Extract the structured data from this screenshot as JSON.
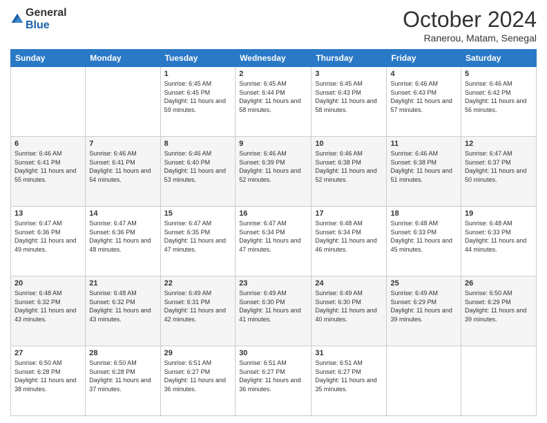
{
  "logo": {
    "general": "General",
    "blue": "Blue"
  },
  "header": {
    "month": "October 2024",
    "location": "Ranerou, Matam, Senegal"
  },
  "days_of_week": [
    "Sunday",
    "Monday",
    "Tuesday",
    "Wednesday",
    "Thursday",
    "Friday",
    "Saturday"
  ],
  "weeks": [
    [
      {
        "day": "",
        "sunrise": "",
        "sunset": "",
        "daylight": ""
      },
      {
        "day": "",
        "sunrise": "",
        "sunset": "",
        "daylight": ""
      },
      {
        "day": "1",
        "sunrise": "Sunrise: 6:45 AM",
        "sunset": "Sunset: 6:45 PM",
        "daylight": "Daylight: 11 hours and 59 minutes."
      },
      {
        "day": "2",
        "sunrise": "Sunrise: 6:45 AM",
        "sunset": "Sunset: 6:44 PM",
        "daylight": "Daylight: 11 hours and 58 minutes."
      },
      {
        "day": "3",
        "sunrise": "Sunrise: 6:45 AM",
        "sunset": "Sunset: 6:43 PM",
        "daylight": "Daylight: 11 hours and 58 minutes."
      },
      {
        "day": "4",
        "sunrise": "Sunrise: 6:46 AM",
        "sunset": "Sunset: 6:43 PM",
        "daylight": "Daylight: 11 hours and 57 minutes."
      },
      {
        "day": "5",
        "sunrise": "Sunrise: 6:46 AM",
        "sunset": "Sunset: 6:42 PM",
        "daylight": "Daylight: 11 hours and 56 minutes."
      }
    ],
    [
      {
        "day": "6",
        "sunrise": "Sunrise: 6:46 AM",
        "sunset": "Sunset: 6:41 PM",
        "daylight": "Daylight: 11 hours and 55 minutes."
      },
      {
        "day": "7",
        "sunrise": "Sunrise: 6:46 AM",
        "sunset": "Sunset: 6:41 PM",
        "daylight": "Daylight: 11 hours and 54 minutes."
      },
      {
        "day": "8",
        "sunrise": "Sunrise: 6:46 AM",
        "sunset": "Sunset: 6:40 PM",
        "daylight": "Daylight: 11 hours and 53 minutes."
      },
      {
        "day": "9",
        "sunrise": "Sunrise: 6:46 AM",
        "sunset": "Sunset: 6:39 PM",
        "daylight": "Daylight: 11 hours and 52 minutes."
      },
      {
        "day": "10",
        "sunrise": "Sunrise: 6:46 AM",
        "sunset": "Sunset: 6:38 PM",
        "daylight": "Daylight: 11 hours and 52 minutes."
      },
      {
        "day": "11",
        "sunrise": "Sunrise: 6:46 AM",
        "sunset": "Sunset: 6:38 PM",
        "daylight": "Daylight: 11 hours and 51 minutes."
      },
      {
        "day": "12",
        "sunrise": "Sunrise: 6:47 AM",
        "sunset": "Sunset: 6:37 PM",
        "daylight": "Daylight: 11 hours and 50 minutes."
      }
    ],
    [
      {
        "day": "13",
        "sunrise": "Sunrise: 6:47 AM",
        "sunset": "Sunset: 6:36 PM",
        "daylight": "Daylight: 11 hours and 49 minutes."
      },
      {
        "day": "14",
        "sunrise": "Sunrise: 6:47 AM",
        "sunset": "Sunset: 6:36 PM",
        "daylight": "Daylight: 11 hours and 48 minutes."
      },
      {
        "day": "15",
        "sunrise": "Sunrise: 6:47 AM",
        "sunset": "Sunset: 6:35 PM",
        "daylight": "Daylight: 11 hours and 47 minutes."
      },
      {
        "day": "16",
        "sunrise": "Sunrise: 6:47 AM",
        "sunset": "Sunset: 6:34 PM",
        "daylight": "Daylight: 11 hours and 47 minutes."
      },
      {
        "day": "17",
        "sunrise": "Sunrise: 6:48 AM",
        "sunset": "Sunset: 6:34 PM",
        "daylight": "Daylight: 11 hours and 46 minutes."
      },
      {
        "day": "18",
        "sunrise": "Sunrise: 6:48 AM",
        "sunset": "Sunset: 6:33 PM",
        "daylight": "Daylight: 11 hours and 45 minutes."
      },
      {
        "day": "19",
        "sunrise": "Sunrise: 6:48 AM",
        "sunset": "Sunset: 6:33 PM",
        "daylight": "Daylight: 11 hours and 44 minutes."
      }
    ],
    [
      {
        "day": "20",
        "sunrise": "Sunrise: 6:48 AM",
        "sunset": "Sunset: 6:32 PM",
        "daylight": "Daylight: 11 hours and 43 minutes."
      },
      {
        "day": "21",
        "sunrise": "Sunrise: 6:48 AM",
        "sunset": "Sunset: 6:32 PM",
        "daylight": "Daylight: 11 hours and 43 minutes."
      },
      {
        "day": "22",
        "sunrise": "Sunrise: 6:49 AM",
        "sunset": "Sunset: 6:31 PM",
        "daylight": "Daylight: 11 hours and 42 minutes."
      },
      {
        "day": "23",
        "sunrise": "Sunrise: 6:49 AM",
        "sunset": "Sunset: 6:30 PM",
        "daylight": "Daylight: 11 hours and 41 minutes."
      },
      {
        "day": "24",
        "sunrise": "Sunrise: 6:49 AM",
        "sunset": "Sunset: 6:30 PM",
        "daylight": "Daylight: 11 hours and 40 minutes."
      },
      {
        "day": "25",
        "sunrise": "Sunrise: 6:49 AM",
        "sunset": "Sunset: 6:29 PM",
        "daylight": "Daylight: 11 hours and 39 minutes."
      },
      {
        "day": "26",
        "sunrise": "Sunrise: 6:50 AM",
        "sunset": "Sunset: 6:29 PM",
        "daylight": "Daylight: 11 hours and 39 minutes."
      }
    ],
    [
      {
        "day": "27",
        "sunrise": "Sunrise: 6:50 AM",
        "sunset": "Sunset: 6:28 PM",
        "daylight": "Daylight: 11 hours and 38 minutes."
      },
      {
        "day": "28",
        "sunrise": "Sunrise: 6:50 AM",
        "sunset": "Sunset: 6:28 PM",
        "daylight": "Daylight: 11 hours and 37 minutes."
      },
      {
        "day": "29",
        "sunrise": "Sunrise: 6:51 AM",
        "sunset": "Sunset: 6:27 PM",
        "daylight": "Daylight: 11 hours and 36 minutes."
      },
      {
        "day": "30",
        "sunrise": "Sunrise: 6:51 AM",
        "sunset": "Sunset: 6:27 PM",
        "daylight": "Daylight: 11 hours and 36 minutes."
      },
      {
        "day": "31",
        "sunrise": "Sunrise: 6:51 AM",
        "sunset": "Sunset: 6:27 PM",
        "daylight": "Daylight: 11 hours and 35 minutes."
      },
      {
        "day": "",
        "sunrise": "",
        "sunset": "",
        "daylight": ""
      },
      {
        "day": "",
        "sunrise": "",
        "sunset": "",
        "daylight": ""
      }
    ]
  ]
}
